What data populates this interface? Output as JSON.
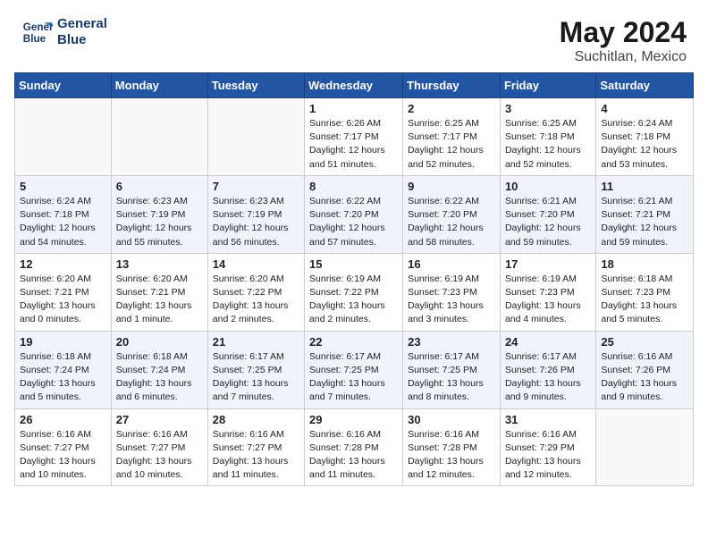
{
  "header": {
    "logo_line1": "General",
    "logo_line2": "Blue",
    "title": "May 2024",
    "subtitle": "Suchitlan, Mexico"
  },
  "days_of_week": [
    "Sunday",
    "Monday",
    "Tuesday",
    "Wednesday",
    "Thursday",
    "Friday",
    "Saturday"
  ],
  "weeks": [
    [
      {
        "day": "",
        "details": ""
      },
      {
        "day": "",
        "details": ""
      },
      {
        "day": "",
        "details": ""
      },
      {
        "day": "1",
        "details": "Sunrise: 6:26 AM\nSunset: 7:17 PM\nDaylight: 12 hours\nand 51 minutes."
      },
      {
        "day": "2",
        "details": "Sunrise: 6:25 AM\nSunset: 7:17 PM\nDaylight: 12 hours\nand 52 minutes."
      },
      {
        "day": "3",
        "details": "Sunrise: 6:25 AM\nSunset: 7:18 PM\nDaylight: 12 hours\nand 52 minutes."
      },
      {
        "day": "4",
        "details": "Sunrise: 6:24 AM\nSunset: 7:18 PM\nDaylight: 12 hours\nand 53 minutes."
      }
    ],
    [
      {
        "day": "5",
        "details": "Sunrise: 6:24 AM\nSunset: 7:18 PM\nDaylight: 12 hours\nand 54 minutes."
      },
      {
        "day": "6",
        "details": "Sunrise: 6:23 AM\nSunset: 7:19 PM\nDaylight: 12 hours\nand 55 minutes."
      },
      {
        "day": "7",
        "details": "Sunrise: 6:23 AM\nSunset: 7:19 PM\nDaylight: 12 hours\nand 56 minutes."
      },
      {
        "day": "8",
        "details": "Sunrise: 6:22 AM\nSunset: 7:20 PM\nDaylight: 12 hours\nand 57 minutes."
      },
      {
        "day": "9",
        "details": "Sunrise: 6:22 AM\nSunset: 7:20 PM\nDaylight: 12 hours\nand 58 minutes."
      },
      {
        "day": "10",
        "details": "Sunrise: 6:21 AM\nSunset: 7:20 PM\nDaylight: 12 hours\nand 59 minutes."
      },
      {
        "day": "11",
        "details": "Sunrise: 6:21 AM\nSunset: 7:21 PM\nDaylight: 12 hours\nand 59 minutes."
      }
    ],
    [
      {
        "day": "12",
        "details": "Sunrise: 6:20 AM\nSunset: 7:21 PM\nDaylight: 13 hours\nand 0 minutes."
      },
      {
        "day": "13",
        "details": "Sunrise: 6:20 AM\nSunset: 7:21 PM\nDaylight: 13 hours\nand 1 minute."
      },
      {
        "day": "14",
        "details": "Sunrise: 6:20 AM\nSunset: 7:22 PM\nDaylight: 13 hours\nand 2 minutes."
      },
      {
        "day": "15",
        "details": "Sunrise: 6:19 AM\nSunset: 7:22 PM\nDaylight: 13 hours\nand 2 minutes."
      },
      {
        "day": "16",
        "details": "Sunrise: 6:19 AM\nSunset: 7:23 PM\nDaylight: 13 hours\nand 3 minutes."
      },
      {
        "day": "17",
        "details": "Sunrise: 6:19 AM\nSunset: 7:23 PM\nDaylight: 13 hours\nand 4 minutes."
      },
      {
        "day": "18",
        "details": "Sunrise: 6:18 AM\nSunset: 7:23 PM\nDaylight: 13 hours\nand 5 minutes."
      }
    ],
    [
      {
        "day": "19",
        "details": "Sunrise: 6:18 AM\nSunset: 7:24 PM\nDaylight: 13 hours\nand 5 minutes."
      },
      {
        "day": "20",
        "details": "Sunrise: 6:18 AM\nSunset: 7:24 PM\nDaylight: 13 hours\nand 6 minutes."
      },
      {
        "day": "21",
        "details": "Sunrise: 6:17 AM\nSunset: 7:25 PM\nDaylight: 13 hours\nand 7 minutes."
      },
      {
        "day": "22",
        "details": "Sunrise: 6:17 AM\nSunset: 7:25 PM\nDaylight: 13 hours\nand 7 minutes."
      },
      {
        "day": "23",
        "details": "Sunrise: 6:17 AM\nSunset: 7:25 PM\nDaylight: 13 hours\nand 8 minutes."
      },
      {
        "day": "24",
        "details": "Sunrise: 6:17 AM\nSunset: 7:26 PM\nDaylight: 13 hours\nand 9 minutes."
      },
      {
        "day": "25",
        "details": "Sunrise: 6:16 AM\nSunset: 7:26 PM\nDaylight: 13 hours\nand 9 minutes."
      }
    ],
    [
      {
        "day": "26",
        "details": "Sunrise: 6:16 AM\nSunset: 7:27 PM\nDaylight: 13 hours\nand 10 minutes."
      },
      {
        "day": "27",
        "details": "Sunrise: 6:16 AM\nSunset: 7:27 PM\nDaylight: 13 hours\nand 10 minutes."
      },
      {
        "day": "28",
        "details": "Sunrise: 6:16 AM\nSunset: 7:27 PM\nDaylight: 13 hours\nand 11 minutes."
      },
      {
        "day": "29",
        "details": "Sunrise: 6:16 AM\nSunset: 7:28 PM\nDaylight: 13 hours\nand 11 minutes."
      },
      {
        "day": "30",
        "details": "Sunrise: 6:16 AM\nSunset: 7:28 PM\nDaylight: 13 hours\nand 12 minutes."
      },
      {
        "day": "31",
        "details": "Sunrise: 6:16 AM\nSunset: 7:29 PM\nDaylight: 13 hours\nand 12 minutes."
      },
      {
        "day": "",
        "details": ""
      }
    ]
  ]
}
